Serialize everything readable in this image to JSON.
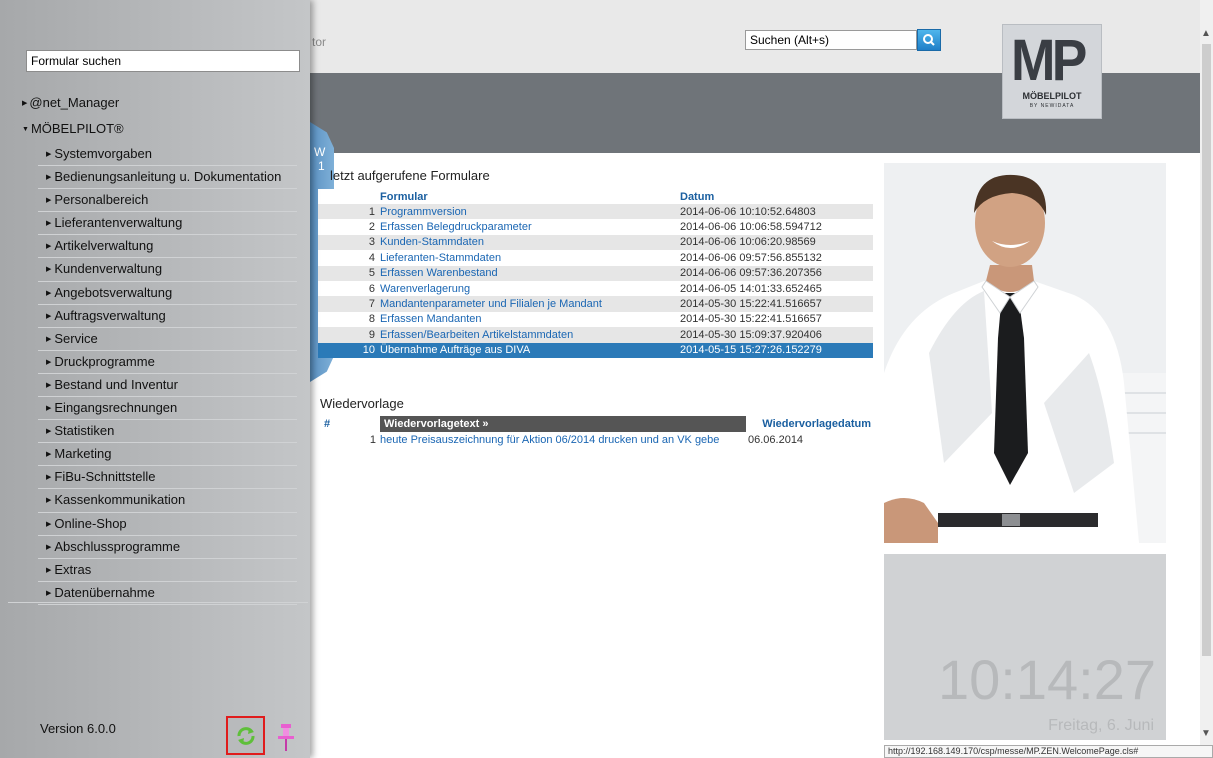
{
  "header": {
    "partial_text": "tor",
    "search_placeholder": "Suchen (Alt+s)"
  },
  "logo": {
    "mark": "MP",
    "name": "MÖBELPILOT",
    "by": "BY NEWIDATA"
  },
  "sidebar": {
    "form_search_value": "Formular suchen",
    "root_items": [
      {
        "label": "@net_Manager"
      },
      {
        "label": "MÖBELPILOT®"
      }
    ],
    "items": [
      {
        "label": "Systemvorgaben"
      },
      {
        "label": "Bedienungsanleitung u. Dokumentation"
      },
      {
        "label": "Personalbereich"
      },
      {
        "label": "Lieferantenverwaltung"
      },
      {
        "label": "Artikelverwaltung"
      },
      {
        "label": "Kundenverwaltung"
      },
      {
        "label": "Angebotsverwaltung"
      },
      {
        "label": "Auftragsverwaltung"
      },
      {
        "label": "Service"
      },
      {
        "label": "Druckprogramme"
      },
      {
        "label": "Bestand und Inventur"
      },
      {
        "label": "Eingangsrechnungen"
      },
      {
        "label": "Statistiken"
      },
      {
        "label": "Marketing"
      },
      {
        "label": "FiBu-Schnittstelle"
      },
      {
        "label": "Kassenkommunikation"
      },
      {
        "label": "Online-Shop"
      },
      {
        "label": "Abschlussprogramme"
      },
      {
        "label": "Extras"
      },
      {
        "label": "Datenübernahme"
      }
    ],
    "version": "Version 6.0.0"
  },
  "tab": {
    "letter1": "W",
    "letter2": "1"
  },
  "recent": {
    "title": "letzt aufgerufene Formulare",
    "col_form": "Formular",
    "col_date": "Datum",
    "rows": [
      {
        "num": "1",
        "form": "Programmversion",
        "date": "2014-06-06 10:10:52.64803"
      },
      {
        "num": "2",
        "form": "Erfassen Belegdruckparameter",
        "date": "2014-06-06 10:06:58.594712"
      },
      {
        "num": "3",
        "form": "Kunden-Stammdaten",
        "date": "2014-06-06 10:06:20.98569"
      },
      {
        "num": "4",
        "form": "Lieferanten-Stammdaten",
        "date": "2014-06-06 09:57:56.855132"
      },
      {
        "num": "5",
        "form": "Erfassen Warenbestand",
        "date": "2014-06-06 09:57:36.207356"
      },
      {
        "num": "6",
        "form": "Warenverlagerung",
        "date": "2014-06-05 14:01:33.652465"
      },
      {
        "num": "7",
        "form": "Mandantenparameter und Filialen je Mandant",
        "date": "2014-05-30 15:22:41.516657"
      },
      {
        "num": "8",
        "form": "Erfassen Mandanten",
        "date": "2014-05-30 15:22:41.516657"
      },
      {
        "num": "9",
        "form": "Erfassen/Bearbeiten Artikelstammdaten",
        "date": "2014-05-30 15:09:37.920406"
      },
      {
        "num": "10",
        "form": "Übernahme Aufträge aus DIVA",
        "date": "2014-05-15 15:27:26.152279"
      }
    ]
  },
  "wiedervorlage": {
    "title": "Wiedervorlage",
    "col_num": "#",
    "col_text": "Wiedervorlagetext »",
    "col_date": "Wiedervorlagedatum",
    "rows": [
      {
        "num": "1",
        "text": "heute Preisauszeichnung für Aktion 06/2014 drucken und an VK gebe",
        "date": "06.06.2014"
      }
    ]
  },
  "clock": {
    "time": "10:14:27",
    "date": "Freitag, 6. Juni"
  },
  "status_bar": {
    "url": "http://192.168.149.170/csp/messe/MP.ZEN.WelcomePage.cls#"
  },
  "colors": {
    "accent": "#2b7ab8",
    "link": "#1a66b3",
    "highlight_border": "#e01c1c"
  }
}
